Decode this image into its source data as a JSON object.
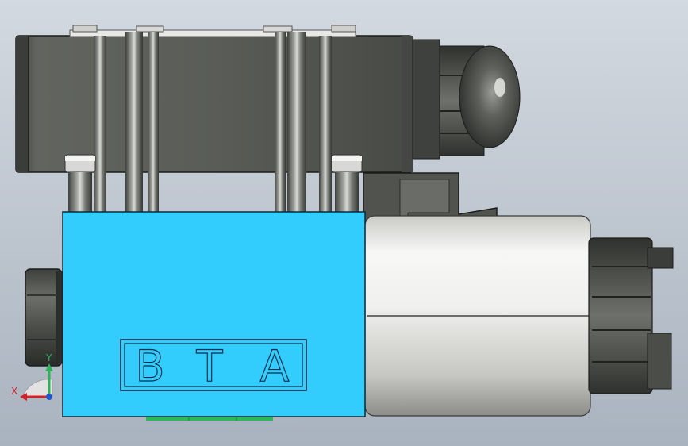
{
  "model": {
    "letters": [
      "B",
      "T",
      "A"
    ],
    "colors": {
      "body": "#33cdfd",
      "housing": "#585b56",
      "coil": "#e4e4e2",
      "background_top": "#c5cdd6",
      "background_bottom": "#a9b3bf",
      "green": "#2fb85a"
    }
  },
  "triad": {
    "x_label": "X",
    "y_label": "Y"
  }
}
